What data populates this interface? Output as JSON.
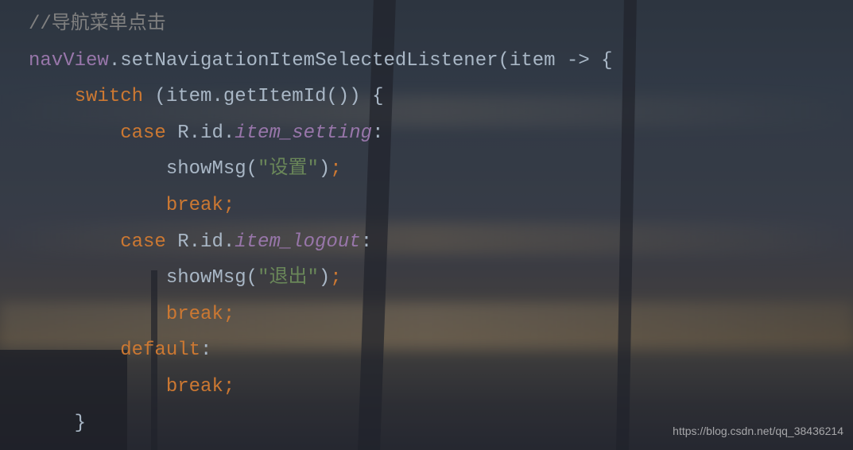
{
  "code": {
    "comment": "//导航菜单点击",
    "navView": "navView",
    "dot1": ".",
    "setListener": "setNavigationItemSelectedListener",
    "parenOpen": "(",
    "item": "item",
    "arrow": " -> ",
    "braceOpen": "{",
    "switch": "switch",
    "spaceParen": " (",
    "item2": "item",
    "dot2": ".",
    "getItemId": "getItemId",
    "parens": "()) ",
    "braceOpen2": "{",
    "case": "case",
    "space": " ",
    "R": "R",
    "dotId": ".id.",
    "itemSetting": "item_setting",
    "colon": ":",
    "showMsg": "showMsg",
    "parenOpen2": "(",
    "strSetting": "\"设置\"",
    "parenClose": ")",
    "semi": ";",
    "break": "break",
    "itemLogout": "item_logout",
    "strLogout": "\"退出\"",
    "default": "default",
    "braceClose": "}"
  },
  "watermark": "https://blog.csdn.net/qq_38436214"
}
